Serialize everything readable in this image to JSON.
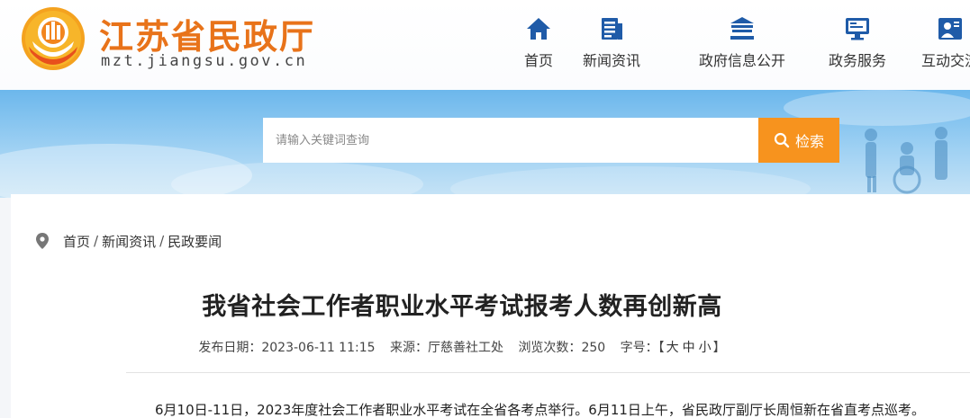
{
  "site": {
    "name_cn": "江苏省民政厅",
    "domain": "mzt.jiangsu.gov.cn",
    "logo_icon": "civil-affairs-emblem"
  },
  "nav": {
    "items": [
      {
        "label": "首页",
        "icon": "home-icon"
      },
      {
        "label": "新闻资讯",
        "icon": "news-icon"
      },
      {
        "label": "政府信息公开",
        "icon": "government-building-icon"
      },
      {
        "label": "政务服务",
        "icon": "monitor-icon"
      },
      {
        "label": "互动交流",
        "icon": "chat-user-icon"
      }
    ]
  },
  "search": {
    "placeholder": "请输入关键词查询",
    "button_label": "检索"
  },
  "breadcrumb": {
    "items": [
      "首页",
      "新闻资讯",
      "民政要闻"
    ],
    "separator": "/"
  },
  "article": {
    "title": "我省社会工作者职业水平考试报考人数再创新高",
    "publish_label": "发布日期：",
    "publish_date": "2023-06-11 11:15",
    "source_label": "来源：",
    "source": "厅慈善社工处",
    "views_label": "浏览次数：",
    "views": "250",
    "font_size_label": "字号：",
    "font_size_open": "【",
    "font_size_options": [
      "大",
      "中",
      "小"
    ],
    "font_size_close": "】",
    "first_paragraph": "6月10日-11日，2023年度社会工作者职业水平考试在全省各考点举行。6月11日上午，省民政厅副厅长周恒新在省直考点巡考。"
  },
  "colors": {
    "brand_orange": "#e8731a",
    "nav_icon_blue": "#1f5ba8",
    "search_button": "#f7931e",
    "banner_sky": "#6cb7ec"
  }
}
